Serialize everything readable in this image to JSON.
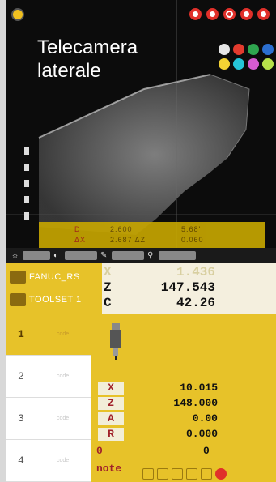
{
  "camera": {
    "title": "Telecamera laterale",
    "bar": {
      "row1_label_left": "D",
      "row1_value1": "2.600",
      "row1_value2": "5.68'",
      "row2_label_left": "ΔX",
      "row2_value1": "2.687 ΔZ",
      "row2_value2": "0.060"
    }
  },
  "machine": {
    "name1": "FANUC_RS",
    "name2": "TOOLSET 1",
    "axes": [
      {
        "axis": "X",
        "value": "1.436"
      },
      {
        "axis": "Z",
        "value": "147.543"
      },
      {
        "axis": "C",
        "value": "42.26"
      }
    ]
  },
  "tools": [
    {
      "number": "1",
      "code": "code",
      "active": true
    },
    {
      "number": "2",
      "code": "code",
      "active": false
    },
    {
      "number": "3",
      "code": "code",
      "active": false
    },
    {
      "number": "4",
      "code": "code",
      "active": false
    }
  ],
  "detail": {
    "values": [
      {
        "label": "X",
        "value": "10.015"
      },
      {
        "label": "Z",
        "value": "148.000"
      },
      {
        "label": "A",
        "value": "0.00"
      },
      {
        "label": "R",
        "value": "0.000"
      }
    ],
    "zero_label": "0",
    "zero_value": "0",
    "note_label": "note"
  },
  "colors": {
    "accent": "#e7c229",
    "label_red": "#a0222a",
    "camera_bg": "#0c0c0c"
  }
}
